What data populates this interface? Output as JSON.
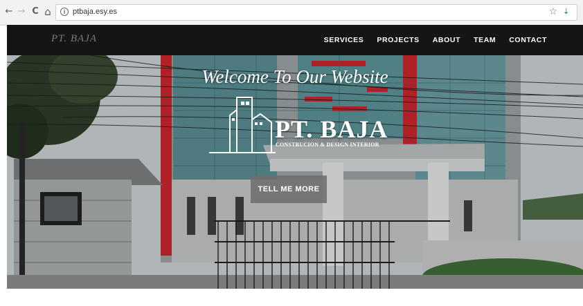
{
  "browser": {
    "back_icon": "←",
    "forward_icon": "→",
    "reload_icon": "C",
    "home_icon": "⌂",
    "url": "ptbaja.esy.es",
    "info_icon": "i",
    "bookmark_icon": "☆",
    "extension_icon": "⇣"
  },
  "nav": {
    "brand": "PT. BAJA",
    "items": [
      {
        "label": "SERVICES"
      },
      {
        "label": "PROJECTS"
      },
      {
        "label": "ABOUT"
      },
      {
        "label": "TEAM"
      },
      {
        "label": "CONTACT"
      }
    ]
  },
  "hero": {
    "headline": "Welcome To Our Website",
    "logo_name": "PT. BAJA",
    "logo_tagline": "CONSTRUCION & DESIGN INTERIOR",
    "cta_label": "TELL ME MORE"
  },
  "colors": {
    "navbar": "#151515",
    "building_accent": "#c8262c",
    "glass": "#4f8f94",
    "cta": "#6e6e6e"
  }
}
